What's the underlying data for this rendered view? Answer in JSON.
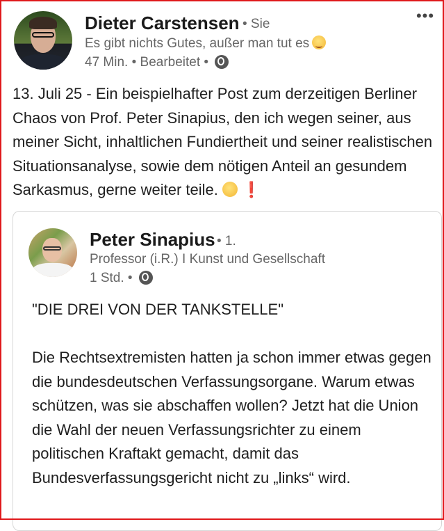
{
  "post": {
    "author": {
      "name": "Dieter Carstensen",
      "degree": "• Sie",
      "headline": "Es gibt nichts Gutes, außer man tut es",
      "time": "47 Min. • Bearbeitet •",
      "avatar_icon": "profile-photo"
    },
    "more_label": "•••",
    "text": "13. Juli 25 - Ein beispielhafter Post zum derzeitigen Berliner Chaos von Prof. Peter Sinapius, den ich wegen seiner, aus meiner Sicht, inhaltlichen Fundiertheit und seiner realistischen Situationsanalyse, sowie dem nötigen Anteil an gesundem Sarkasmus, gerne weiter teile.",
    "text_suffix_exclaim": "❗"
  },
  "shared": {
    "author": {
      "name": "Peter Sinapius",
      "degree": "• 1.",
      "headline": "Professor (i.R.) I Kunst und Gesellschaft",
      "time": "1 Std. •",
      "avatar_icon": "profile-photo"
    },
    "title": "\"DIE DREI VON DER TANKSTELLE\"",
    "body": "Die Rechtsextremisten hatten ja schon immer etwas gegen die bundesdeutschen Verfassungsorgane. Warum etwas schützen, was sie abschaffen wollen? Jetzt hat die Union die Wahl der neuen Verfassungsrichter zu einem politischen Kraftakt gemacht, damit das Bundesverfassungsgericht nicht zu „links“ wird."
  },
  "colors": {
    "frame": "#e0191c",
    "text": "#1f1f1f",
    "muted": "#666666",
    "card_border": "#d6d6d6"
  },
  "icons": [
    "globe-icon",
    "wink-emoji-icon",
    "more-options-icon",
    "exclamation-icon"
  ]
}
